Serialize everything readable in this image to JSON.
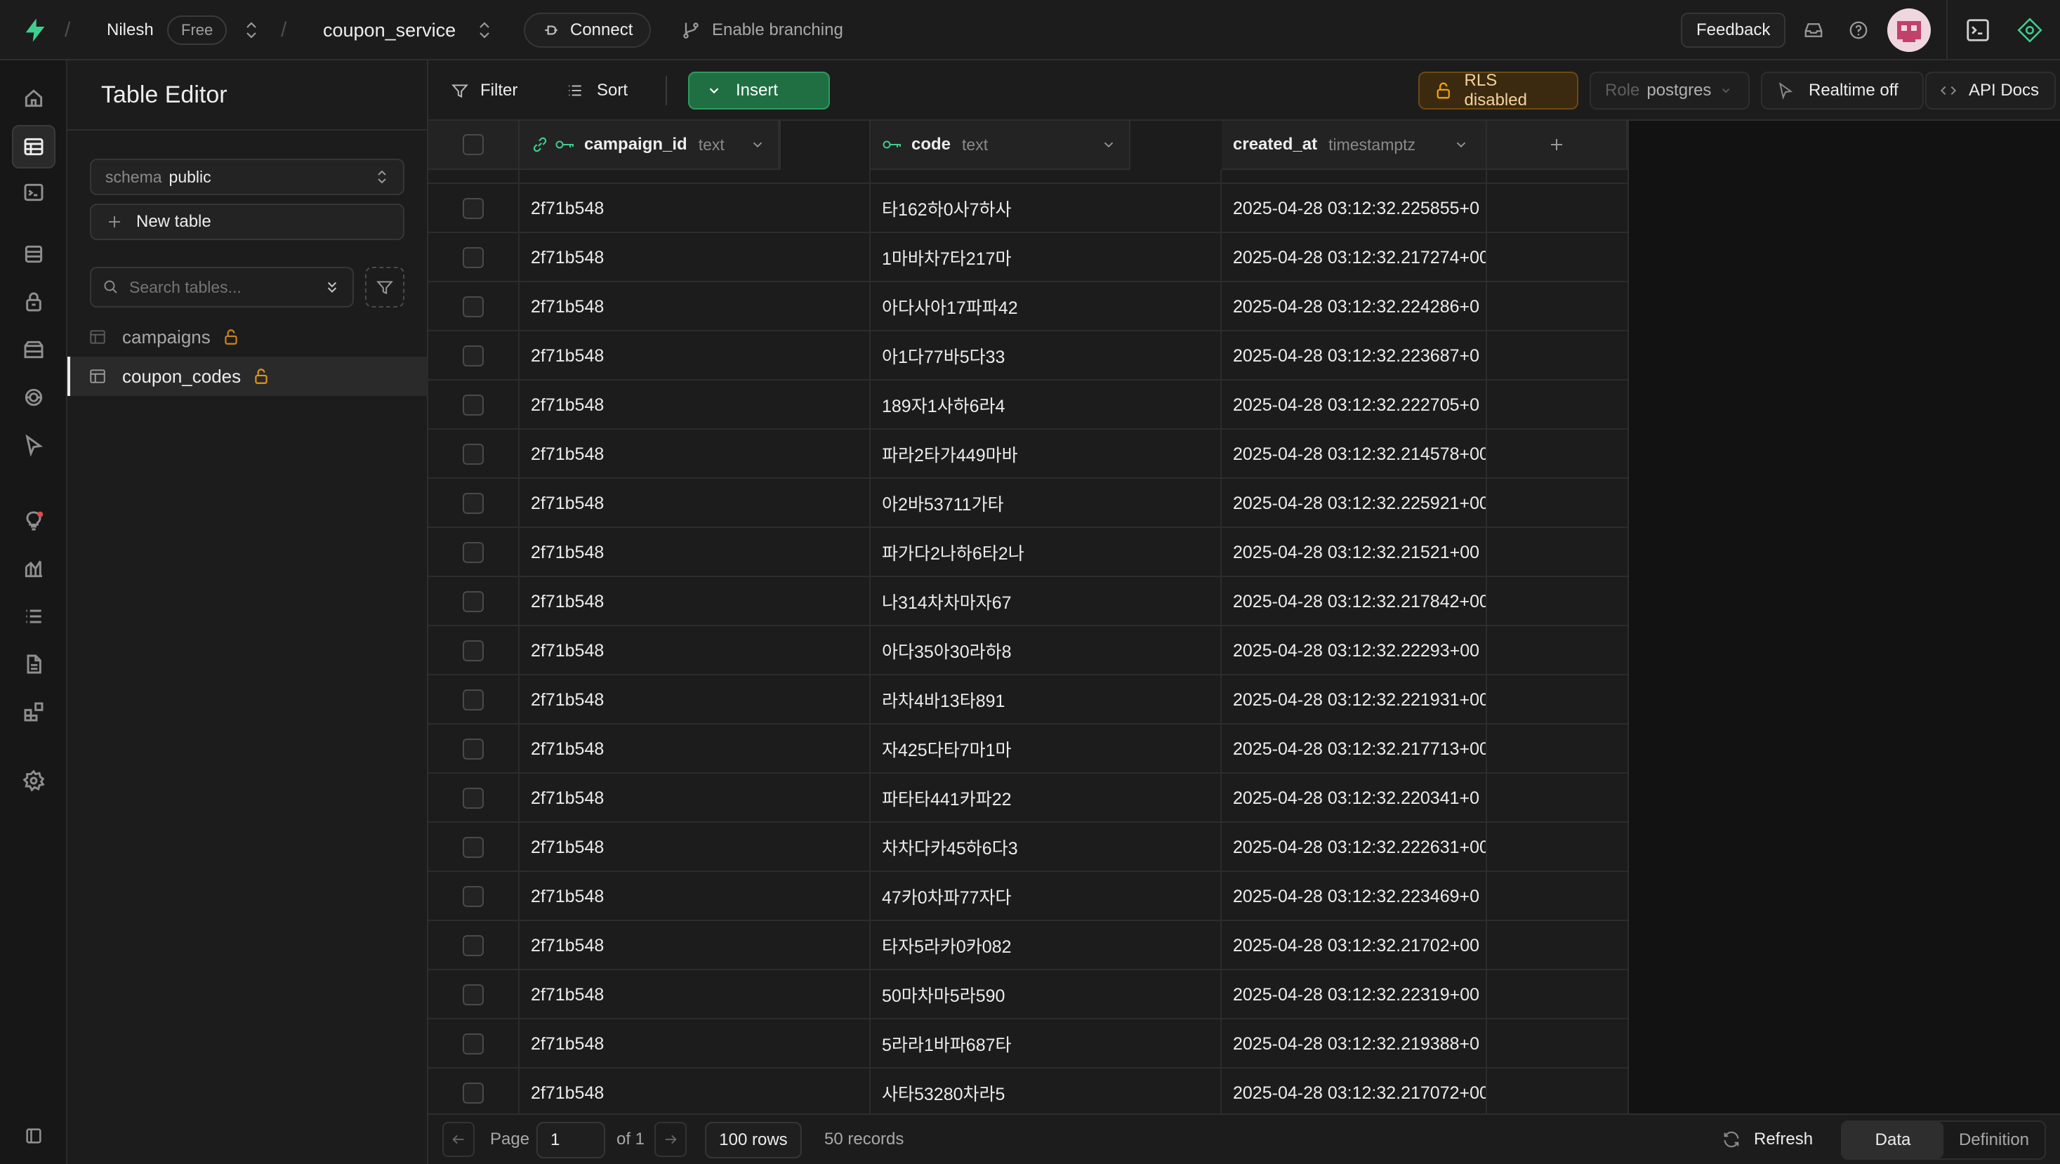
{
  "topbar": {
    "org_name": "Nilesh",
    "plan_badge": "Free",
    "project_name": "coupon_service",
    "connect_label": "Connect",
    "branching_label": "Enable branching",
    "feedback_label": "Feedback"
  },
  "leftnav": {
    "icons": [
      "home-icon",
      "table-editor-icon",
      "sql-editor-icon",
      "database-icon",
      "auth-icon",
      "storage-icon",
      "realtime-icon",
      "edge-functions-icon",
      "advisors-icon",
      "reports-icon",
      "logs-icon",
      "api-docs-icon",
      "integrations-icon",
      "settings-icon"
    ]
  },
  "sidepanel": {
    "title": "Table Editor",
    "schema_label": "schema",
    "schema_value": "public",
    "new_table_label": "New table",
    "search_placeholder": "Search tables...",
    "tables": [
      {
        "name": "campaigns",
        "active": false
      },
      {
        "name": "coupon_codes",
        "active": true
      }
    ]
  },
  "toolbar": {
    "filter_label": "Filter",
    "sort_label": "Sort",
    "insert_label": "Insert",
    "rls_label": "RLS disabled",
    "role_label": "Role",
    "role_value": "postgres",
    "realtime_label": "Realtime off",
    "api_docs_label": "API Docs"
  },
  "columns": [
    {
      "name": "campaign_id",
      "type": "text"
    },
    {
      "name": "code",
      "type": "text"
    },
    {
      "name": "created_at",
      "type": "timestamptz"
    }
  ],
  "rows": [
    {
      "campaign_id": "2f71b548",
      "code": "타162하0사7하사",
      "created_at": "2025-04-28 03:12:32.225855+0"
    },
    {
      "campaign_id": "2f71b548",
      "code": "1마바차7타217마",
      "created_at": "2025-04-28 03:12:32.217274+00"
    },
    {
      "campaign_id": "2f71b548",
      "code": "아다사아17파파42",
      "created_at": "2025-04-28 03:12:32.224286+0"
    },
    {
      "campaign_id": "2f71b548",
      "code": "아1다77바5다33",
      "created_at": "2025-04-28 03:12:32.223687+0"
    },
    {
      "campaign_id": "2f71b548",
      "code": "189자1사하6라4",
      "created_at": "2025-04-28 03:12:32.222705+0"
    },
    {
      "campaign_id": "2f71b548",
      "code": "파라2타가449마바",
      "created_at": "2025-04-28 03:12:32.214578+00"
    },
    {
      "campaign_id": "2f71b548",
      "code": "아2바53711가타",
      "created_at": "2025-04-28 03:12:32.225921+00"
    },
    {
      "campaign_id": "2f71b548",
      "code": "파가다2나하6타2나",
      "created_at": "2025-04-28 03:12:32.21521+00"
    },
    {
      "campaign_id": "2f71b548",
      "code": "나314차차마자67",
      "created_at": "2025-04-28 03:12:32.217842+00"
    },
    {
      "campaign_id": "2f71b548",
      "code": "아다35아30라하8",
      "created_at": "2025-04-28 03:12:32.22293+00"
    },
    {
      "campaign_id": "2f71b548",
      "code": "라차4바13타891",
      "created_at": "2025-04-28 03:12:32.221931+00"
    },
    {
      "campaign_id": "2f71b548",
      "code": "자425다타7마1마",
      "created_at": "2025-04-28 03:12:32.217713+00"
    },
    {
      "campaign_id": "2f71b548",
      "code": "파타타441카파22",
      "created_at": "2025-04-28 03:12:32.220341+0"
    },
    {
      "campaign_id": "2f71b548",
      "code": "차차다카45하6다3",
      "created_at": "2025-04-28 03:12:32.222631+00"
    },
    {
      "campaign_id": "2f71b548",
      "code": "47카0차파77자다",
      "created_at": "2025-04-28 03:12:32.223469+0"
    },
    {
      "campaign_id": "2f71b548",
      "code": "타자5라카0카082",
      "created_at": "2025-04-28 03:12:32.21702+00"
    },
    {
      "campaign_id": "2f71b548",
      "code": "50마차마5라590",
      "created_at": "2025-04-28 03:12:32.22319+00"
    },
    {
      "campaign_id": "2f71b548",
      "code": "5라라1바파687타",
      "created_at": "2025-04-28 03:12:32.219388+0"
    },
    {
      "campaign_id": "2f71b548",
      "code": "사타53280차라5",
      "created_at": "2025-04-28 03:12:32.217072+00"
    }
  ],
  "footer": {
    "page_label": "Page",
    "page_value": "1",
    "of_label": "of 1",
    "rows_label": "100 rows",
    "records_label": "50 records",
    "refresh_label": "Refresh",
    "data_tab": "Data",
    "definition_tab": "Definition"
  },
  "colors": {
    "accent_green": "#3ecf8e",
    "insert_bg": "#1f6f43",
    "rls_orange": "#f1a10d",
    "background": "#121212"
  }
}
